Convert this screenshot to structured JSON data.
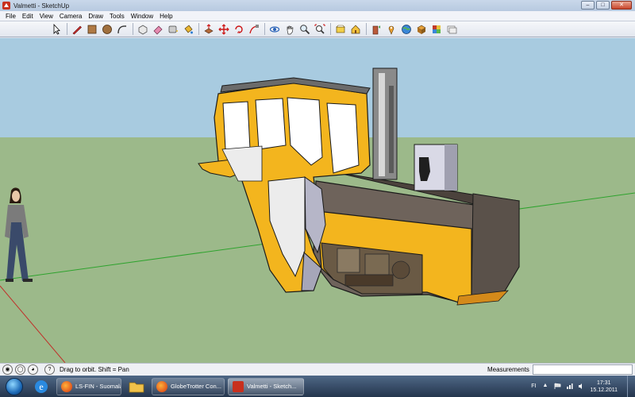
{
  "window": {
    "title": "Valmetti - SketchUp",
    "controls": {
      "minimize": "–",
      "maximize": "□",
      "close": "✕"
    }
  },
  "menubar": {
    "items": [
      "File",
      "Edit",
      "View",
      "Camera",
      "Draw",
      "Tools",
      "Window",
      "Help"
    ]
  },
  "toolbar": {
    "tools": [
      "select-arrow",
      "pencil-line",
      "rectangle",
      "circle",
      "arc",
      "make-component",
      "eraser",
      "tape-measure",
      "paint-bucket",
      "push-pull",
      "move",
      "rotate",
      "follow-me",
      "orbit",
      "pan",
      "zoom",
      "zoom-extents",
      "previous-view",
      "get-models",
      "share-model",
      "place-model",
      "get-photo-texture",
      "components",
      "materials",
      "styles"
    ]
  },
  "statusbar": {
    "hint": "Drag to orbit.  Shift = Pan",
    "measurements_label": "Measurements",
    "measurements_value": ""
  },
  "taskbar": {
    "buttons": [
      {
        "label": "LS-FIN - Suomalai...",
        "color": "#e2581c"
      },
      {
        "label": "GlobeTrotter Con...",
        "color": "#e2581c"
      },
      {
        "label": "Valmetti - Sketch...",
        "color": "#c8301e"
      }
    ],
    "language": "FI",
    "time": "17:31",
    "date": "15.12.2011"
  },
  "colors": {
    "sky": "#a8cbe0",
    "ground": "#9cb98a",
    "cab_yellow": "#f3b51e",
    "hood_gray": "#6e635b"
  }
}
